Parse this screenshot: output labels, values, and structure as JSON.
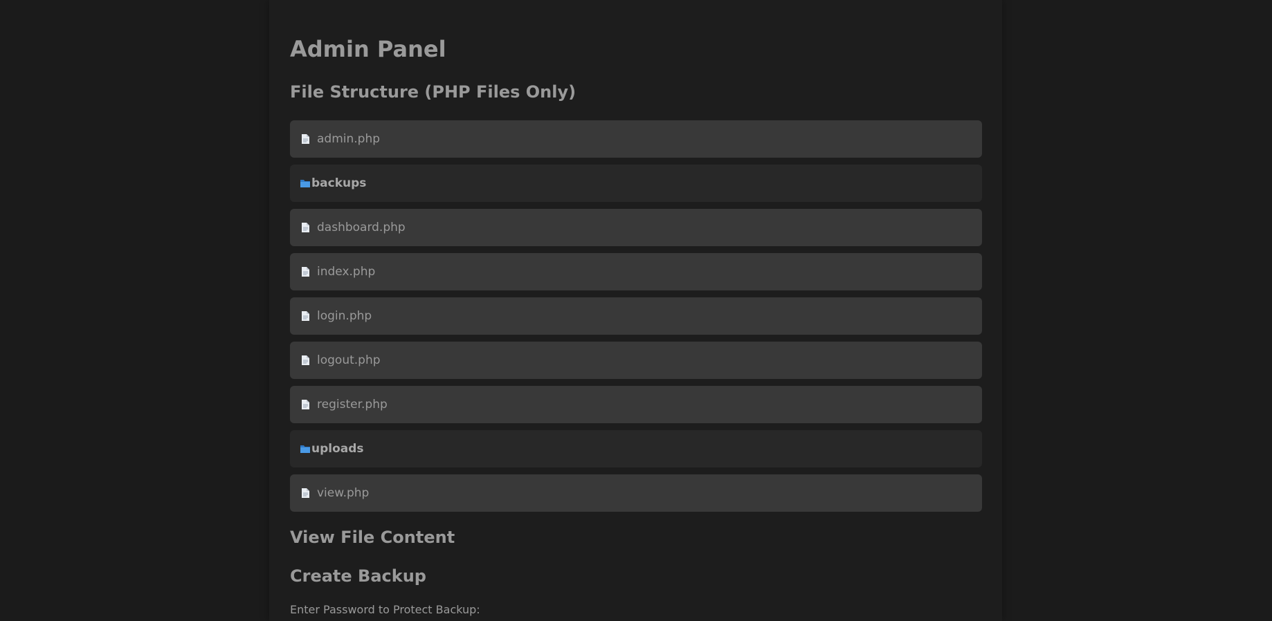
{
  "page": {
    "title": "Admin Panel"
  },
  "file_structure": {
    "heading": "File Structure (PHP Files Only)",
    "items": [
      {
        "type": "file",
        "name": "admin.php",
        "icon": "file-icon"
      },
      {
        "type": "folder",
        "name": "backups",
        "icon": "folder-icon"
      },
      {
        "type": "file",
        "name": "dashboard.php",
        "icon": "file-icon"
      },
      {
        "type": "file",
        "name": "index.php",
        "icon": "file-icon"
      },
      {
        "type": "file",
        "name": "login.php",
        "icon": "file-icon"
      },
      {
        "type": "file",
        "name": "logout.php",
        "icon": "file-icon"
      },
      {
        "type": "file",
        "name": "register.php",
        "icon": "file-icon"
      },
      {
        "type": "folder",
        "name": "uploads",
        "icon": "folder-icon"
      },
      {
        "type": "file",
        "name": "view.php",
        "icon": "file-icon"
      }
    ]
  },
  "view_content": {
    "heading": "View File Content"
  },
  "backup": {
    "heading": "Create Backup",
    "password_label": "Enter Password to Protect Backup:"
  },
  "colors": {
    "page_bg": "#1b1b1b",
    "panel_bg": "#1d1d1d",
    "file_row_bg": "#393939",
    "folder_row_bg": "#282828",
    "text": "#9a9a9a",
    "folder_icon": "#3d8fdc"
  }
}
